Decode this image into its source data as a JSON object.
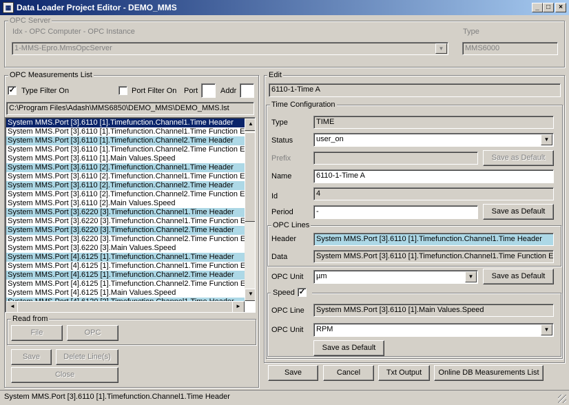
{
  "window": {
    "title": "Data Loader Project Editor - DEMO_MMS",
    "min": "_",
    "max": "□",
    "close": "×"
  },
  "opc_server": {
    "group_label": "OPC Server",
    "idx_label": "Idx - OPC Computer - OPC Instance",
    "server_value": "1-MMS-Epro.MmsOpcServer",
    "type_label": "Type",
    "type_value": "MMS6000"
  },
  "measurements": {
    "group_label": "OPC Measurements List",
    "type_filter_label": "Type Filter On",
    "type_filter_checked": "✓",
    "port_filter_label": "Port Filter On",
    "port_label": "Port",
    "addr_label": "Addr",
    "port_value": "",
    "addr_value": "",
    "path": "C:\\Program Files\\Adash\\MMS6850\\DEMO_MMS\\DEMO_MMS.lst",
    "rows": [
      "System MMS.Port [3].6110 [1].Timefunction.Channel1.Time Header",
      "System MMS.Port [3].6110 [1].Timefunction.Channel1.Time Function Eu",
      "System MMS.Port [3].6110 [1].Timefunction.Channel2.Time Header",
      "System MMS.Port [3].6110 [1].Timefunction.Channel2.Time Function Eu",
      "System MMS.Port [3].6110 [1].Main Values.Speed",
      "System MMS.Port [3].6110 [2].Timefunction.Channel1.Time Header",
      "System MMS.Port [3].6110 [2].Timefunction.Channel1.Time Function Eu",
      "System MMS.Port [3].6110 [2].Timefunction.Channel2.Time Header",
      "System MMS.Port [3].6110 [2].Timefunction.Channel2.Time Function Eu",
      "System MMS.Port [3].6110 [2].Main Values.Speed",
      "System MMS.Port [3].6220 [3].Timefunction.Channel1.Time Header",
      "System MMS.Port [3].6220 [3].Timefunction.Channel1.Time Function Eu",
      "System MMS.Port [3].6220 [3].Timefunction.Channel2.Time Header",
      "System MMS.Port [3].6220 [3].Timefunction.Channel2.Time Function Eu",
      "System MMS.Port [3].6220 [3].Main Values.Speed",
      "System MMS.Port [4].6125 [1].Timefunction.Channel1.Time Header",
      "System MMS.Port [4].6125 [1].Timefunction.Channel1.Time Function Eu",
      "System MMS.Port [4].6125 [1].Timefunction.Channel2.Time Header",
      "System MMS.Port [4].6125 [1].Timefunction.Channel2.Time Function Eu",
      "System MMS.Port [4].6125 [1].Main Values.Speed",
      "System MMS.Port [4].6120 [2].Timefunction.Channel1.Time Header"
    ],
    "read_from_label": "Read from",
    "file_btn": "File",
    "opc_btn": "OPC",
    "save_btn": "Save",
    "delete_btn": "Delete Line(s)",
    "close_btn": "Close"
  },
  "edit": {
    "group_label": "Edit",
    "name_value": "6110-1-Time A",
    "time_config_label": "Time Configuration",
    "type_label": "Type",
    "type_value": "TIME",
    "status_label": "Status",
    "status_value": "user_on",
    "prefix_label": "Prefix",
    "prefix_value": "",
    "name_label": "Name",
    "name_field": "6110-1-Time A",
    "id_label": "Id",
    "id_value": "4",
    "period_label": "Period",
    "period_value": "-",
    "save_default": "Save as Default",
    "opc_lines_label": "OPC Lines",
    "header_label": "Header",
    "header_value": "System MMS.Port [3].6110 [1].Timefunction.Channel1.Time Header",
    "data_label": "Data",
    "data_value": "System MMS.Port [3].6110 [1].Timefunction.Channel1.Time Function Eu",
    "opc_unit_label": "OPC Unit",
    "opc_unit_value": "µm",
    "speed_label": "Speed",
    "speed_checked": "✓",
    "opc_line_label": "OPC Line",
    "opc_line_value": "System MMS.Port [3].6110 [1].Main Values.Speed",
    "speed_unit_label": "OPC Unit",
    "speed_unit_value": "RPM"
  },
  "bottom": {
    "save": "Save",
    "cancel": "Cancel",
    "txt": "Txt Output",
    "online": "Online DB Measurements List"
  },
  "status": "System MMS.Port [3].6110 [1].Timefunction.Channel1.Time Header",
  "arrow_down": "▼",
  "arrow_up": "▲",
  "arrow_left": "◄",
  "arrow_right": "►"
}
